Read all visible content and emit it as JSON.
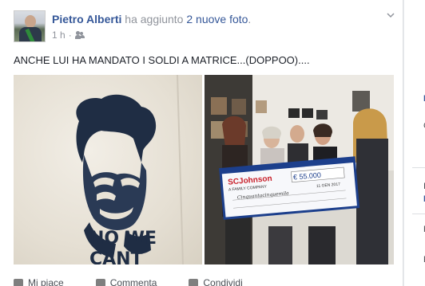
{
  "post": {
    "author": "Pietro Alberti",
    "action_text": " ha aggiunto ",
    "photos_link": "2 nuove foto",
    "action_end": ".",
    "time": "1 h",
    "dot": "·",
    "audience_icon": "friends-icon",
    "text": "ANCHE LUI HA MANDATO I SOLDI A MATRICE...(DOPPOO)....",
    "stencil_text_1": "NO WE",
    "stencil_text_2": "CANT",
    "check_amount": "€ 55.000",
    "check_brand": "SCJohnson",
    "check_tagline": "A FAMILY COMPANY",
    "check_date": "11 GEN 2017",
    "check_line": "Cinquantacinquemila"
  },
  "actions": {
    "like": "Mi piace",
    "comment": "Commenta",
    "share": "Condividi"
  },
  "sidebar": {
    "letters": [
      "L",
      "C",
      "I",
      "F",
      "F",
      "F"
    ]
  },
  "colors": {
    "link": "#365899",
    "meta": "#90949c",
    "text": "#1d2129",
    "background": "#e9ebee"
  }
}
